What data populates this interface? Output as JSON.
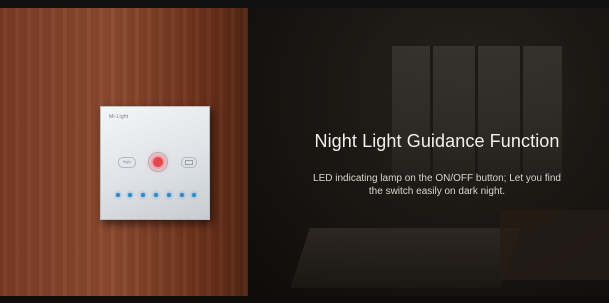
{
  "heading": "Night Light Guidance Function",
  "description_line1": "LED indicating lamp on the ON/OFF button; Let you find",
  "description_line2": "the switch easily on dark night.",
  "panel": {
    "brand": "Mi-Light",
    "night_button_label": "Night",
    "power_led_color": "#e8464f",
    "slider_led_color": "#2a8ad0"
  }
}
